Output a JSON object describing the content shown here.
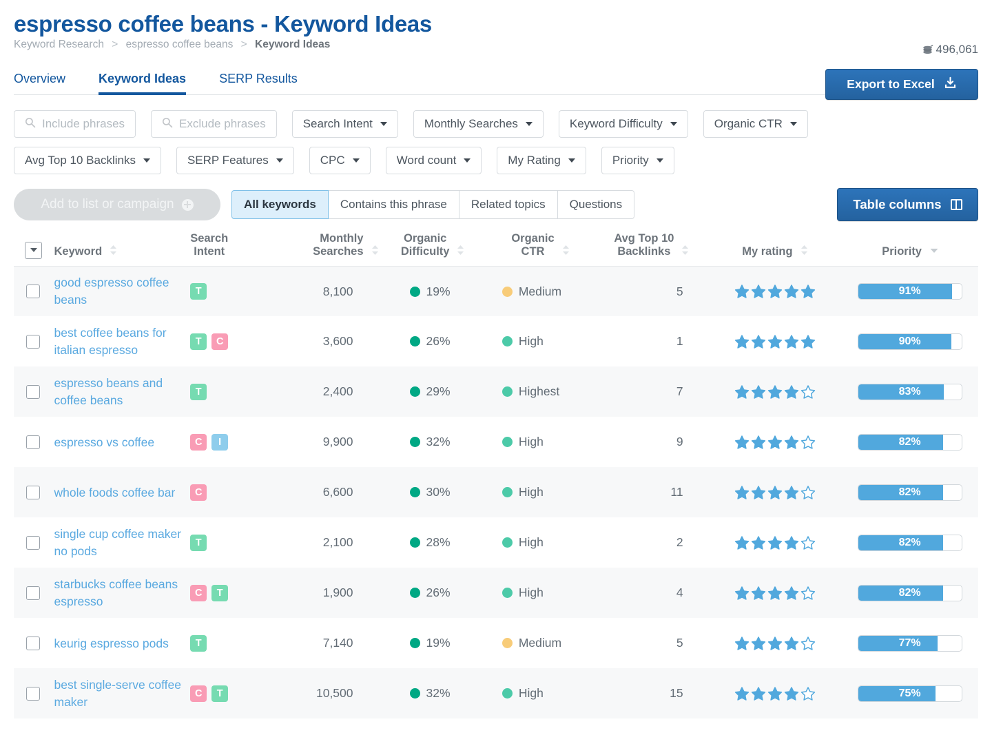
{
  "header": {
    "title": "espresso coffee beans - Keyword Ideas",
    "breadcrumb": {
      "root": "Keyword Research",
      "middle": "espresso coffee beans",
      "current": "Keyword Ideas",
      "separator": ">"
    },
    "credits": "496,061",
    "credits_icon": "coins-icon",
    "export_label": "Export to Excel",
    "export_icon": "download-icon"
  },
  "tabs": [
    {
      "label": "Overview",
      "active": false
    },
    {
      "label": "Keyword Ideas",
      "active": true
    },
    {
      "label": "SERP Results",
      "active": false
    }
  ],
  "filters": {
    "row1": [
      {
        "label": "Include phrases",
        "type": "search",
        "value": "",
        "placeholder": "Include phrases"
      },
      {
        "label": "Exclude phrases",
        "type": "search",
        "value": "",
        "placeholder": "Exclude phrases"
      },
      {
        "label": "Search Intent",
        "type": "dropdown"
      },
      {
        "label": "Monthly Searches",
        "type": "dropdown"
      },
      {
        "label": "Keyword Difficulty",
        "type": "dropdown"
      },
      {
        "label": "Organic CTR",
        "type": "dropdown"
      }
    ],
    "row2": [
      {
        "label": "Avg Top 10 Backlinks",
        "type": "dropdown"
      },
      {
        "label": "SERP Features",
        "type": "dropdown"
      },
      {
        "label": "CPC",
        "type": "dropdown"
      },
      {
        "label": "Word count",
        "type": "dropdown"
      },
      {
        "label": "My Rating",
        "type": "dropdown"
      },
      {
        "label": "Priority",
        "type": "dropdown"
      }
    ]
  },
  "toolbar": {
    "add_to_list_label": "Add to list or campaign",
    "add_to_list_icon": "plus-circle-icon",
    "segments": [
      {
        "label": "All keywords",
        "active": true
      },
      {
        "label": "Contains this phrase",
        "active": false
      },
      {
        "label": "Related topics",
        "active": false
      },
      {
        "label": "Questions",
        "active": false
      }
    ],
    "table_columns_label": "Table columns",
    "table_columns_icon": "columns-icon"
  },
  "table": {
    "columns": [
      {
        "key": "check",
        "label": "",
        "sort": "select-all",
        "align": "left"
      },
      {
        "key": "keyword",
        "label": "Keyword",
        "sort": "both",
        "align": "left"
      },
      {
        "key": "intent",
        "label": "Search\nIntent",
        "sort": "none",
        "align": "left"
      },
      {
        "key": "searches",
        "label": "Monthly\nSearches",
        "sort": "both",
        "align": "right"
      },
      {
        "key": "difficulty",
        "label": "Organic\nDifficulty",
        "sort": "both",
        "align": "left"
      },
      {
        "key": "ctr",
        "label": "Organic\nCTR",
        "sort": "both",
        "align": "left"
      },
      {
        "key": "backlinks",
        "label": "Avg Top 10\nBacklinks",
        "sort": "both",
        "align": "right"
      },
      {
        "key": "rating",
        "label": "My rating",
        "sort": "both",
        "align": "center"
      },
      {
        "key": "priority",
        "label": "Priority",
        "sort": "desc",
        "align": "center"
      }
    ],
    "column_labels": {
      "keyword": "Keyword",
      "intent_l1": "Search",
      "intent_l2": "Intent",
      "searches_l1": "Monthly",
      "searches_l2": "Searches",
      "difficulty_l1": "Organic",
      "difficulty_l2": "Difficulty",
      "ctr_l1": "Organic",
      "ctr_l2": "CTR",
      "backlinks_l1": "Avg Top 10",
      "backlinks_l2": "Backlinks",
      "rating": "My rating",
      "priority": "Priority"
    },
    "rows": [
      {
        "keyword": "good espresso coffee beans",
        "intents": [
          "T"
        ],
        "searches": "8,100",
        "difficulty": "19%",
        "difficulty_level": "low",
        "ctr": "Medium",
        "ctr_level": "medium",
        "backlinks": "5",
        "rating": 5,
        "priority": "91%",
        "priority_value": 91
      },
      {
        "keyword": "best coffee beans for italian espresso",
        "intents": [
          "T",
          "C"
        ],
        "searches": "3,600",
        "difficulty": "26%",
        "difficulty_level": "low",
        "ctr": "High",
        "ctr_level": "high",
        "backlinks": "1",
        "rating": 5,
        "priority": "90%",
        "priority_value": 90
      },
      {
        "keyword": "espresso beans and coffee beans",
        "intents": [
          "T"
        ],
        "searches": "2,400",
        "difficulty": "29%",
        "difficulty_level": "low",
        "ctr": "Highest",
        "ctr_level": "high",
        "backlinks": "7",
        "rating": 4,
        "priority": "83%",
        "priority_value": 83
      },
      {
        "keyword": "espresso vs coffee",
        "intents": [
          "C",
          "I"
        ],
        "searches": "9,900",
        "difficulty": "32%",
        "difficulty_level": "low",
        "ctr": "High",
        "ctr_level": "high",
        "backlinks": "9",
        "rating": 4,
        "priority": "82%",
        "priority_value": 82
      },
      {
        "keyword": "whole foods coffee bar",
        "intents": [
          "C"
        ],
        "searches": "6,600",
        "difficulty": "30%",
        "difficulty_level": "low",
        "ctr": "High",
        "ctr_level": "high",
        "backlinks": "11",
        "rating": 4,
        "priority": "82%",
        "priority_value": 82
      },
      {
        "keyword": "single cup coffee maker no pods",
        "intents": [
          "T"
        ],
        "searches": "2,100",
        "difficulty": "28%",
        "difficulty_level": "low",
        "ctr": "High",
        "ctr_level": "high",
        "backlinks": "2",
        "rating": 4,
        "priority": "82%",
        "priority_value": 82
      },
      {
        "keyword": "starbucks coffee beans espresso",
        "intents": [
          "C",
          "T"
        ],
        "searches": "1,900",
        "difficulty": "26%",
        "difficulty_level": "low",
        "ctr": "High",
        "ctr_level": "high",
        "backlinks": "4",
        "rating": 4,
        "priority": "82%",
        "priority_value": 82
      },
      {
        "keyword": "keurig espresso pods",
        "intents": [
          "T"
        ],
        "searches": "7,140",
        "difficulty": "19%",
        "difficulty_level": "low",
        "ctr": "Medium",
        "ctr_level": "medium",
        "backlinks": "5",
        "rating": 4,
        "priority": "77%",
        "priority_value": 77
      },
      {
        "keyword": "best single-serve coffee maker",
        "intents": [
          "C",
          "T"
        ],
        "searches": "10,500",
        "difficulty": "32%",
        "difficulty_level": "low",
        "ctr": "High",
        "ctr_level": "high",
        "backlinks": "15",
        "rating": 4,
        "priority": "75%",
        "priority_value": 75
      }
    ]
  },
  "colors": {
    "brand_blue": "#13579e",
    "link_blue": "#5aa9e0",
    "accent_blue": "#51a8dd",
    "difficulty_low": "#00a884",
    "ctr_high": "#4ccaa8",
    "ctr_medium": "#f8cc79",
    "badge_transactional": "#76dbb1",
    "badge_commercial": "#f99cb5",
    "badge_informational": "#8ecdec",
    "row_stripe": "#f7f8f9"
  }
}
